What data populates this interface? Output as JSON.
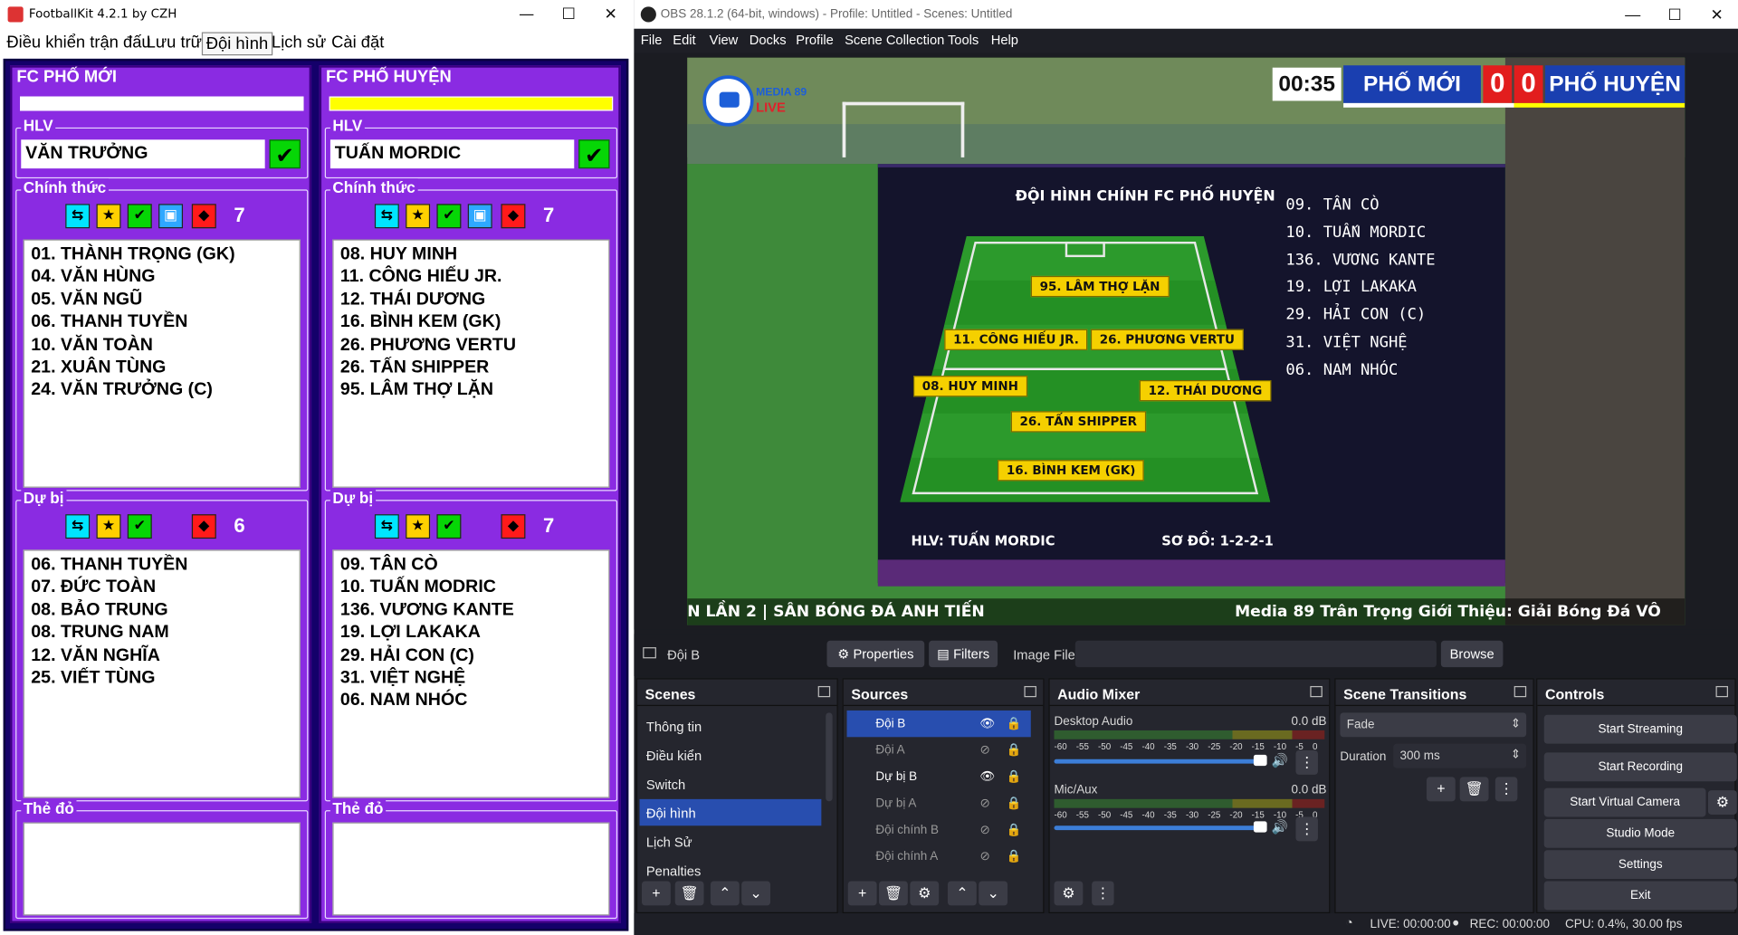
{
  "footballkit": {
    "title": "FootballKit 4.2.1 by CZH",
    "menu": [
      "Điều khiển trận đấu",
      "Lưu trữ",
      "Đội hình",
      "Lịch sử",
      "Cài đặt"
    ],
    "active_tab": "Đội hình",
    "labels": {
      "coach": "HLV",
      "starting": "Chính thức",
      "subs": "Dự bị",
      "red_cards": "Thẻ đỏ"
    },
    "team_a": {
      "name": "FC PHỐ MỚI",
      "color": "#ffffff",
      "coach": "VĂN TRƯỞNG",
      "starting_count": "7",
      "starting": [
        "01. THÀNH TRỌNG (GK)",
        "04. VĂN HÙNG",
        "05. VĂN NGŨ",
        "06. THANH TUYỀN",
        "10. VĂN TOÀN",
        "21. XUÂN TÙNG",
        "24. VĂN TRƯỞNG (C)"
      ],
      "subs_count": "6",
      "subs": [
        "06. THANH TUYỀN",
        "07. ĐỨC TOÀN",
        "08. BẢO TRUNG",
        "08. TRUNG NAM",
        "12. VĂN NGHĨA",
        "25. VIẾT TÙNG"
      ]
    },
    "team_b": {
      "name": "FC PHỐ HUYỆN",
      "color": "#ffff00",
      "coach": "TUẤN MORDIC",
      "starting_count": "7",
      "starting": [
        "08. HUY MINH",
        "11. CÔNG HIẾU JR.",
        "12. THÁI DƯƠNG",
        "16. BÌNH KEM (GK)",
        "26. PHƯƠNG VERTU",
        "26. TẤN SHIPPER",
        "95. LÂM THỢ LẶN"
      ],
      "subs_count": "7",
      "subs": [
        "09. TÂN CÒ",
        "10. TUẤN MODRIC",
        "136. VƯƠNG KANTE",
        "19. LỢI LAKAKA",
        "29. HẢI CON (C)",
        "31. VIỆT NGHỆ",
        "06. NAM NHÓC"
      ]
    }
  },
  "obs": {
    "title": "OBS 28.1.2 (64-bit, windows) - Profile: Untitled - Scenes: Untitled",
    "menu": [
      "File",
      "Edit",
      "View",
      "Docks",
      "Profile",
      "Scene Collection",
      "Tools",
      "Help"
    ],
    "preview": {
      "brand": "MEDIA 89",
      "live": "LIVE",
      "clock": "00:35",
      "home": "PHỐ MỚI",
      "home_score": "0",
      "away_score": "0",
      "away": "PHỐ HUYỆN",
      "lineup_title": "ĐỘI HÌNH CHÍNH FC PHỐ HUYỆN",
      "pitch_players": [
        "95. LÂM THỢ LẶN",
        "11. CÔNG HIẾU JR.",
        "26. PHƯƠNG VERTU",
        "08. HUY MINH",
        "12. THÁI DƯƠNG",
        "26. TẤN SHIPPER",
        "16. BÌNH KEM (GK)"
      ],
      "subs": [
        "09. TÂN CÒ",
        "10. TUẤN MORDIC",
        "136. VƯƠNG KANTE",
        "19. LỢI LAKAKA",
        "29. HẢI CON (C)",
        "31. VIỆT NGHỆ",
        "06. NAM NHÓC"
      ],
      "coach": "HLV: TUẤN MORDIC",
      "formation": "SƠ ĐỒ: 1-2-2-1",
      "ticker_left": "N LẦN 2 | SÂN BÓNG ĐÁ ANH TIẾN",
      "ticker_right": "Media 89 Trân Trọng Giới Thiệu: Giải Bóng Đá VÔ"
    },
    "source_bar": {
      "source": "Đội B",
      "properties": "Properties",
      "filters": "Filters",
      "image_file": "Image File",
      "browse": "Browse"
    },
    "scenes": {
      "title": "Scenes",
      "items": [
        "Thông tin",
        "Điều kiển",
        "Switch",
        "Đội hình",
        "Lịch Sử",
        "Penalties"
      ],
      "selected": "Đội hình"
    },
    "sources": {
      "title": "Sources",
      "items": [
        "Đội B",
        "Đội A",
        "Dự bị B",
        "Dự bị A",
        "Đội chính B",
        "Đội chính A"
      ]
    },
    "audio": {
      "title": "Audio Mixer",
      "channels": [
        {
          "name": "Desktop Audio",
          "db": "0.0 dB"
        },
        {
          "name": "Mic/Aux",
          "db": "0.0 dB"
        }
      ],
      "scale": [
        "-60",
        "-55",
        "-50",
        "-45",
        "-40",
        "-35",
        "-30",
        "-25",
        "-20",
        "-15",
        "-10",
        "-5",
        "0"
      ]
    },
    "transitions": {
      "title": "Scene Transitions",
      "type": "Fade",
      "duration_label": "Duration",
      "duration": "300 ms"
    },
    "controls": {
      "title": "Controls",
      "buttons": [
        "Start Streaming",
        "Start Recording",
        "Start Virtual Camera",
        "Studio Mode",
        "Settings",
        "Exit"
      ]
    },
    "status": {
      "live": "LIVE: 00:00:00",
      "rec": "REC: 00:00:00",
      "cpu": "CPU: 0.4%, 30.00 fps"
    }
  }
}
